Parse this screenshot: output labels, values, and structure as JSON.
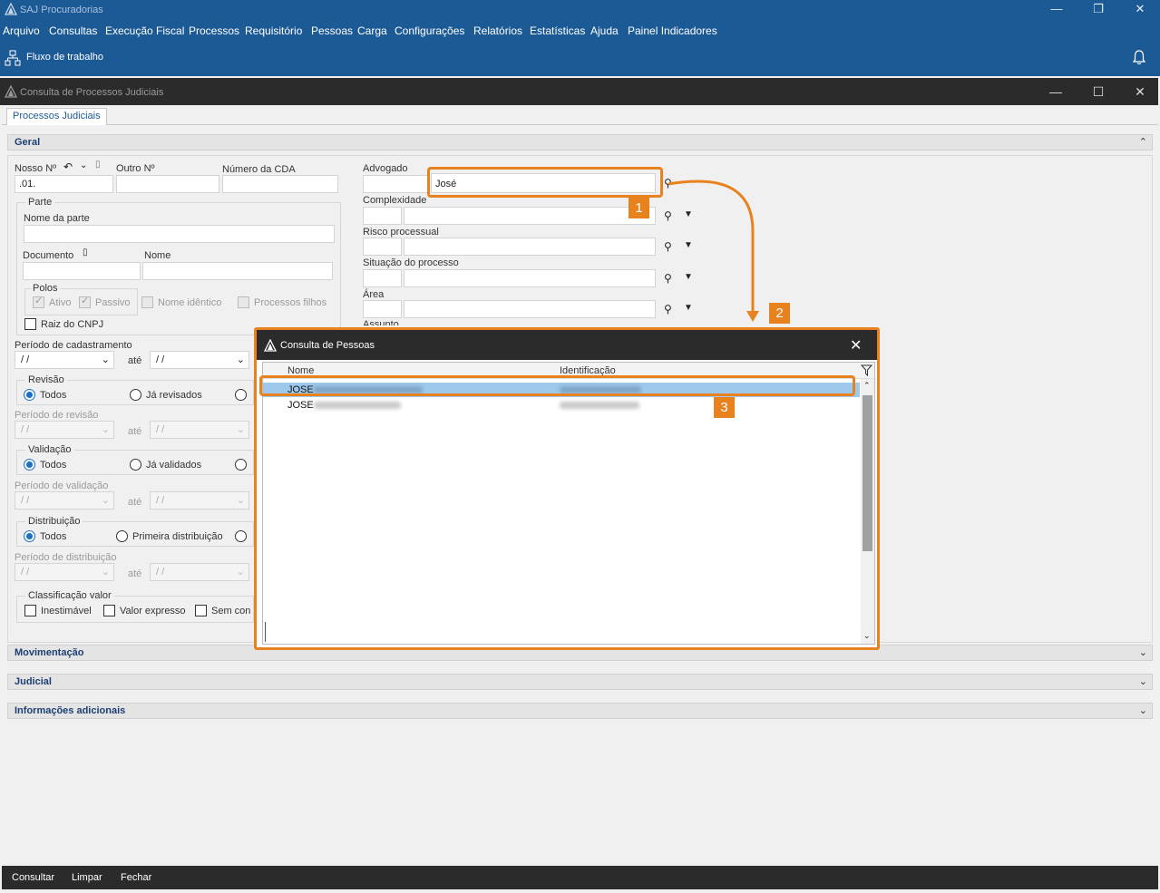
{
  "app": {
    "title": "SAJ Procuradorias"
  },
  "menu": [
    "Arquivo",
    "Consultas",
    "Execução Fiscal",
    "Processos",
    "Requisitório",
    "Pessoas",
    "Carga",
    "Configurações",
    "Relatórios",
    "Estatísticas",
    "Ajuda",
    "Painel Indicadores"
  ],
  "toolbar": {
    "workflow_label": "Fluxo de trabalho"
  },
  "window": {
    "title": "Consulta de Processos Judiciais",
    "tab": "Processos Judiciais"
  },
  "sections": {
    "geral": "Geral",
    "movimentacao": "Movimentação",
    "judicial": "Judicial",
    "informacoes": "Informações adicionais"
  },
  "form": {
    "nosso_no_label": "Nosso Nº",
    "nosso_no_value": ".01.",
    "outro_no_label": "Outro Nº",
    "numero_cda_label": "Número da CDA",
    "parte_group": "Parte",
    "nome_parte_label": "Nome da parte",
    "documento_label": "Documento",
    "nome_label": "Nome",
    "polos_group": "Polos",
    "ativo": "Ativo",
    "passivo": "Passivo",
    "nome_identico": "Nome idêntico",
    "processos_filhos": "Processos filhos",
    "raiz_cnpj": "Raiz do CNPJ",
    "periodo_cadastramento": "Período de cadastramento",
    "date_blank": "/ /",
    "ate": "até",
    "revisao_group": "Revisão",
    "todos": "Todos",
    "ja_revisados": "Já revisados",
    "periodo_revisao": "Período de revisão",
    "validacao_group": "Validação",
    "ja_validados": "Já validados",
    "periodo_validacao": "Período de validação",
    "distribuicao_group": "Distribuição",
    "primeira_distribuicao": "Primeira distribuição",
    "periodo_distribuicao": "Período de distribuição",
    "classificacao_group": "Classificação valor",
    "inestimavel": "Inestimável",
    "valor_expresso": "Valor expresso",
    "sem_conteudo": "Sem con",
    "advogado_label": "Advogado",
    "advogado_value": "José",
    "complexidade_label": "Complexidade",
    "risco_label": "Risco processual",
    "situacao_label": "Situação do processo",
    "area_label": "Área",
    "assunto_label": "Assunto"
  },
  "modal": {
    "title": "Consulta de Pessoas",
    "columns": [
      "Nome",
      "Identificação"
    ],
    "rows": [
      {
        "nome": "JOSE"
      },
      {
        "nome": "JOSE"
      }
    ]
  },
  "callouts": [
    "1",
    "2",
    "3"
  ],
  "bottom": {
    "consultar": "Consultar",
    "limpar": "Limpar",
    "fechar": "Fechar"
  },
  "colors": {
    "brand_blue": "#1c5a96",
    "callout_orange": "#e8821e",
    "selection": "#9ec9ec"
  }
}
